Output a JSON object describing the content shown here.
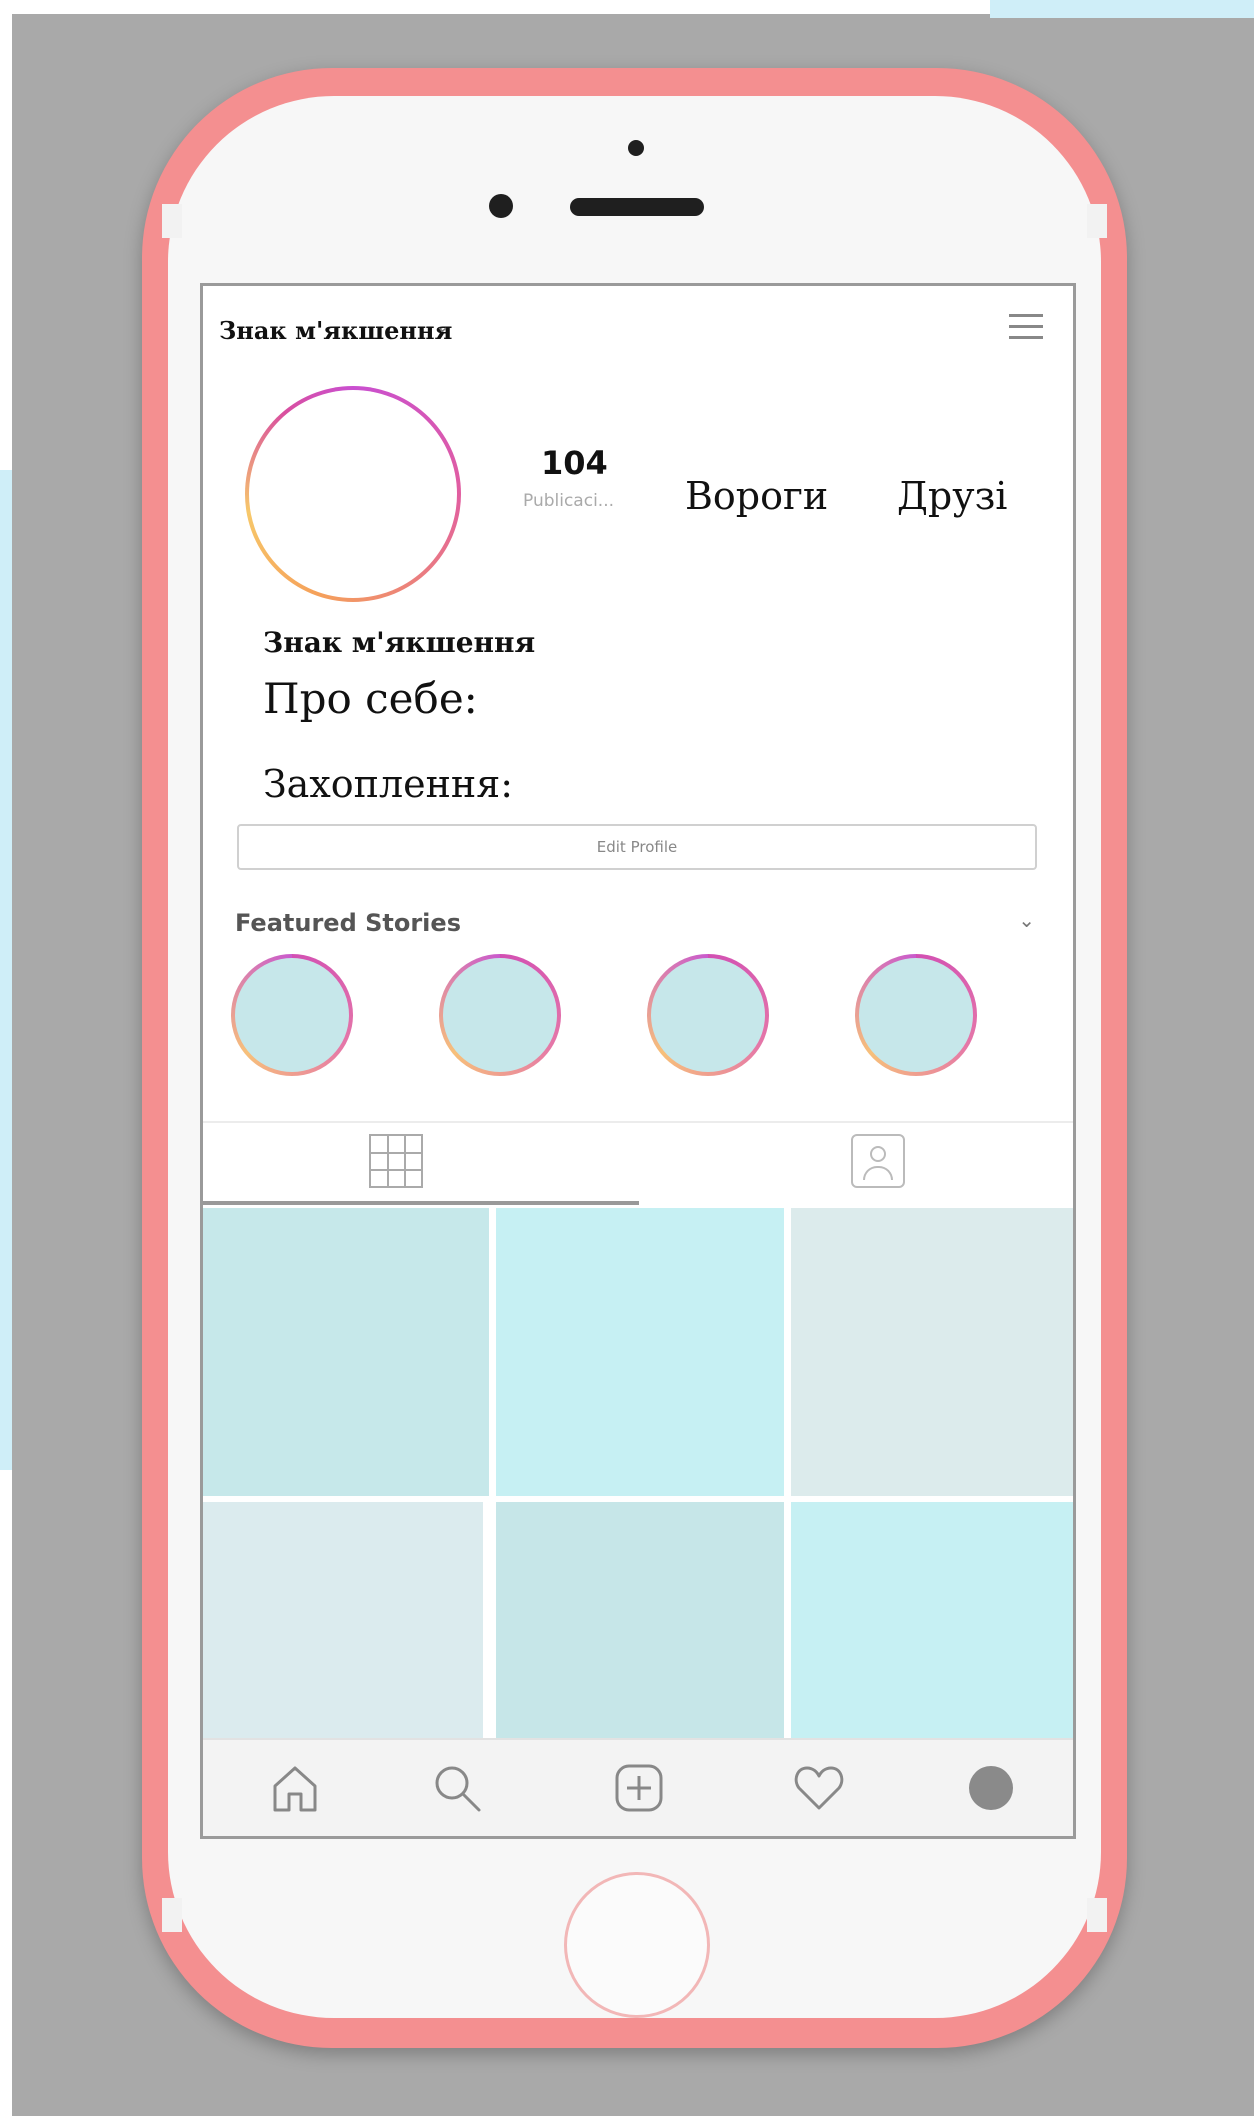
{
  "header": {
    "account_name": "Знак м'якшення",
    "chevron": "⌄",
    "menu_icon": "hamburger-menu-icon"
  },
  "profile": {
    "posts_count": "104",
    "posts_label": "Publicaci...",
    "enemies_label": "Вороги",
    "friends_label": "Друзі",
    "name": "Знак м'якшення",
    "about_label": "Про себе:",
    "hobbies_label": "Захоплення:",
    "edit_button": "Edit Profile"
  },
  "featured": {
    "title": "Featured Stories",
    "chevron": "⌄",
    "stories": [
      {
        "color": "#c6e7ea"
      },
      {
        "color": "#c6e7ea"
      },
      {
        "color": "#c6e7ea"
      },
      {
        "color": "#c6e7ea"
      }
    ]
  },
  "tabs": {
    "items": [
      {
        "icon": "grid-icon",
        "active": true
      },
      {
        "icon": "tagged-person-icon",
        "active": false
      }
    ]
  },
  "posts": [
    {
      "color": "#c6e8ea"
    },
    {
      "color": "#c6f0f3"
    },
    {
      "color": "#dcebec"
    },
    {
      "color": "#dbebee"
    },
    {
      "color": "#c6e6e8"
    },
    {
      "color": "#c6f0f3"
    }
  ],
  "bottom_nav": {
    "items": [
      {
        "icon": "home-icon"
      },
      {
        "icon": "search-icon"
      },
      {
        "icon": "add-post-icon"
      },
      {
        "icon": "heart-icon"
      },
      {
        "icon": "profile-avatar-icon"
      }
    ]
  },
  "colors": {
    "phone_body": "#f48f90",
    "background": "#a9a9a9",
    "accent_blue": "#c6f0f3"
  }
}
